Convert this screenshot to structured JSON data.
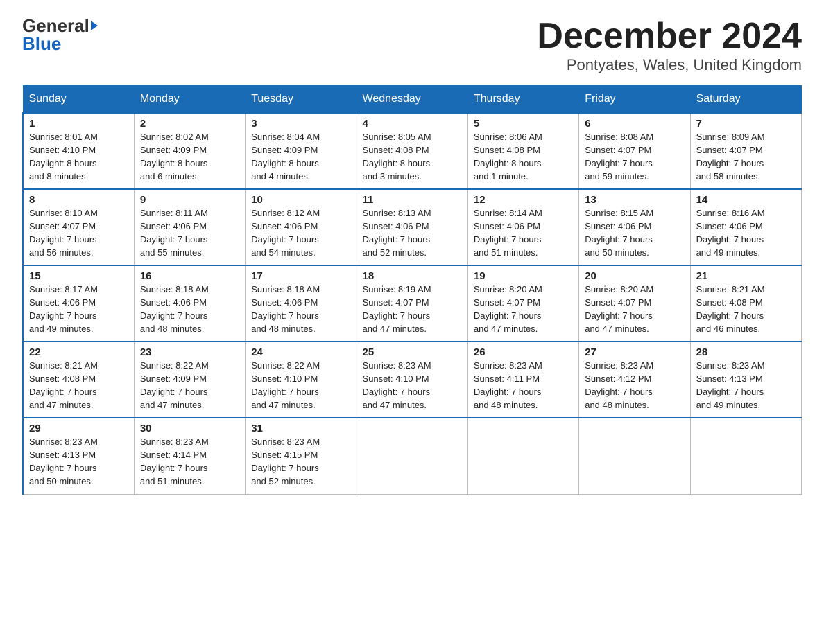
{
  "logo": {
    "general": "General",
    "blue": "Blue"
  },
  "title": "December 2024",
  "location": "Pontyates, Wales, United Kingdom",
  "days_of_week": [
    "Sunday",
    "Monday",
    "Tuesday",
    "Wednesday",
    "Thursday",
    "Friday",
    "Saturday"
  ],
  "weeks": [
    [
      {
        "num": "1",
        "info": "Sunrise: 8:01 AM\nSunset: 4:10 PM\nDaylight: 8 hours\nand 8 minutes."
      },
      {
        "num": "2",
        "info": "Sunrise: 8:02 AM\nSunset: 4:09 PM\nDaylight: 8 hours\nand 6 minutes."
      },
      {
        "num": "3",
        "info": "Sunrise: 8:04 AM\nSunset: 4:09 PM\nDaylight: 8 hours\nand 4 minutes."
      },
      {
        "num": "4",
        "info": "Sunrise: 8:05 AM\nSunset: 4:08 PM\nDaylight: 8 hours\nand 3 minutes."
      },
      {
        "num": "5",
        "info": "Sunrise: 8:06 AM\nSunset: 4:08 PM\nDaylight: 8 hours\nand 1 minute."
      },
      {
        "num": "6",
        "info": "Sunrise: 8:08 AM\nSunset: 4:07 PM\nDaylight: 7 hours\nand 59 minutes."
      },
      {
        "num": "7",
        "info": "Sunrise: 8:09 AM\nSunset: 4:07 PM\nDaylight: 7 hours\nand 58 minutes."
      }
    ],
    [
      {
        "num": "8",
        "info": "Sunrise: 8:10 AM\nSunset: 4:07 PM\nDaylight: 7 hours\nand 56 minutes."
      },
      {
        "num": "9",
        "info": "Sunrise: 8:11 AM\nSunset: 4:06 PM\nDaylight: 7 hours\nand 55 minutes."
      },
      {
        "num": "10",
        "info": "Sunrise: 8:12 AM\nSunset: 4:06 PM\nDaylight: 7 hours\nand 54 minutes."
      },
      {
        "num": "11",
        "info": "Sunrise: 8:13 AM\nSunset: 4:06 PM\nDaylight: 7 hours\nand 52 minutes."
      },
      {
        "num": "12",
        "info": "Sunrise: 8:14 AM\nSunset: 4:06 PM\nDaylight: 7 hours\nand 51 minutes."
      },
      {
        "num": "13",
        "info": "Sunrise: 8:15 AM\nSunset: 4:06 PM\nDaylight: 7 hours\nand 50 minutes."
      },
      {
        "num": "14",
        "info": "Sunrise: 8:16 AM\nSunset: 4:06 PM\nDaylight: 7 hours\nand 49 minutes."
      }
    ],
    [
      {
        "num": "15",
        "info": "Sunrise: 8:17 AM\nSunset: 4:06 PM\nDaylight: 7 hours\nand 49 minutes."
      },
      {
        "num": "16",
        "info": "Sunrise: 8:18 AM\nSunset: 4:06 PM\nDaylight: 7 hours\nand 48 minutes."
      },
      {
        "num": "17",
        "info": "Sunrise: 8:18 AM\nSunset: 4:06 PM\nDaylight: 7 hours\nand 48 minutes."
      },
      {
        "num": "18",
        "info": "Sunrise: 8:19 AM\nSunset: 4:07 PM\nDaylight: 7 hours\nand 47 minutes."
      },
      {
        "num": "19",
        "info": "Sunrise: 8:20 AM\nSunset: 4:07 PM\nDaylight: 7 hours\nand 47 minutes."
      },
      {
        "num": "20",
        "info": "Sunrise: 8:20 AM\nSunset: 4:07 PM\nDaylight: 7 hours\nand 47 minutes."
      },
      {
        "num": "21",
        "info": "Sunrise: 8:21 AM\nSunset: 4:08 PM\nDaylight: 7 hours\nand 46 minutes."
      }
    ],
    [
      {
        "num": "22",
        "info": "Sunrise: 8:21 AM\nSunset: 4:08 PM\nDaylight: 7 hours\nand 47 minutes."
      },
      {
        "num": "23",
        "info": "Sunrise: 8:22 AM\nSunset: 4:09 PM\nDaylight: 7 hours\nand 47 minutes."
      },
      {
        "num": "24",
        "info": "Sunrise: 8:22 AM\nSunset: 4:10 PM\nDaylight: 7 hours\nand 47 minutes."
      },
      {
        "num": "25",
        "info": "Sunrise: 8:23 AM\nSunset: 4:10 PM\nDaylight: 7 hours\nand 47 minutes."
      },
      {
        "num": "26",
        "info": "Sunrise: 8:23 AM\nSunset: 4:11 PM\nDaylight: 7 hours\nand 48 minutes."
      },
      {
        "num": "27",
        "info": "Sunrise: 8:23 AM\nSunset: 4:12 PM\nDaylight: 7 hours\nand 48 minutes."
      },
      {
        "num": "28",
        "info": "Sunrise: 8:23 AM\nSunset: 4:13 PM\nDaylight: 7 hours\nand 49 minutes."
      }
    ],
    [
      {
        "num": "29",
        "info": "Sunrise: 8:23 AM\nSunset: 4:13 PM\nDaylight: 7 hours\nand 50 minutes."
      },
      {
        "num": "30",
        "info": "Sunrise: 8:23 AM\nSunset: 4:14 PM\nDaylight: 7 hours\nand 51 minutes."
      },
      {
        "num": "31",
        "info": "Sunrise: 8:23 AM\nSunset: 4:15 PM\nDaylight: 7 hours\nand 52 minutes."
      },
      null,
      null,
      null,
      null
    ]
  ]
}
